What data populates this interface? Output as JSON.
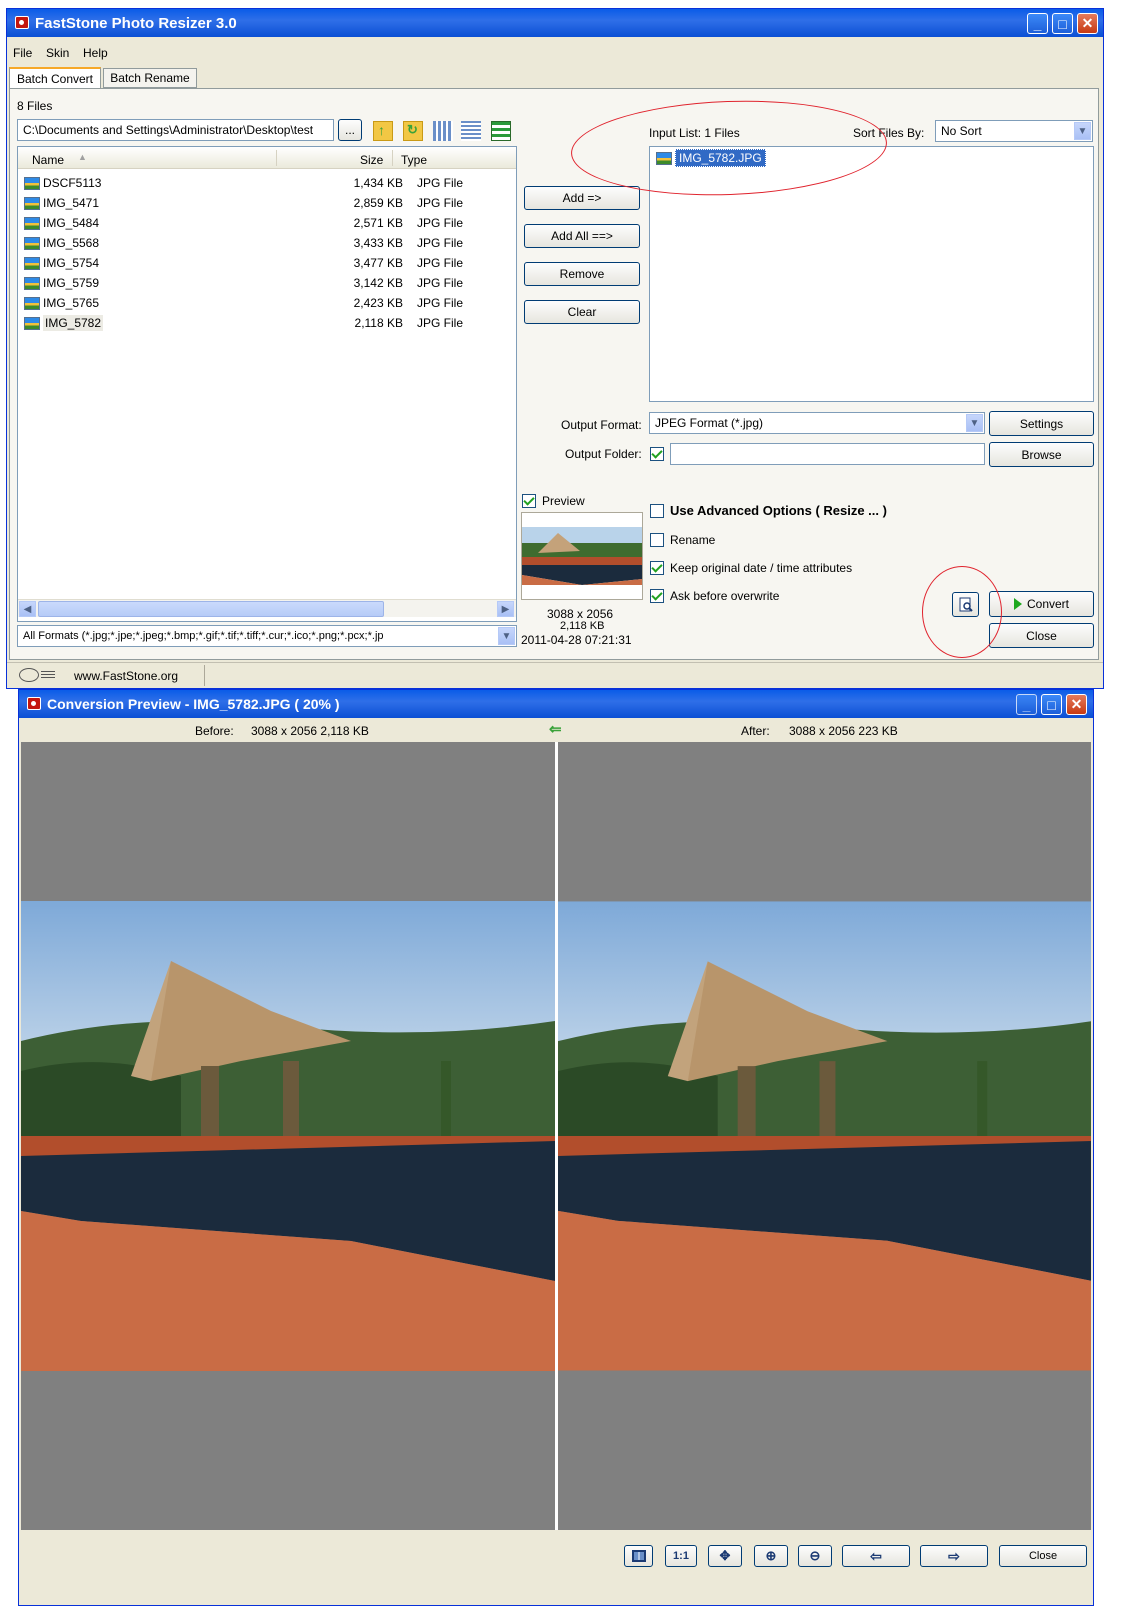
{
  "main_window": {
    "title": "FastStone Photo Resizer 3.0",
    "menu": [
      "File",
      "Skin",
      "Help"
    ],
    "tabs": [
      "Batch Convert",
      "Batch Rename"
    ],
    "files_count": "8 Files",
    "path": "C:\\Documents and Settings\\Administrator\\Desktop\\test",
    "browse_btn": "...",
    "columns": {
      "name": "Name",
      "size": "Size",
      "type": "Type"
    },
    "files": [
      {
        "name": "DSCF5113",
        "size": "1,434 KB",
        "type": "JPG File"
      },
      {
        "name": "IMG_5471",
        "size": "2,859 KB",
        "type": "JPG File"
      },
      {
        "name": "IMG_5484",
        "size": "2,571 KB",
        "type": "JPG File"
      },
      {
        "name": "IMG_5568",
        "size": "3,433 KB",
        "type": "JPG File"
      },
      {
        "name": "IMG_5754",
        "size": "3,477 KB",
        "type": "JPG File"
      },
      {
        "name": "IMG_5759",
        "size": "3,142 KB",
        "type": "JPG File"
      },
      {
        "name": "IMG_5765",
        "size": "2,423 KB",
        "type": "JPG File"
      },
      {
        "name": "IMG_5782",
        "size": "2,118 KB",
        "type": "JPG File"
      }
    ],
    "filter": "All Formats (*.jpg;*.jpe;*.jpeg;*.bmp;*.gif;*.tif;*.tiff;*.cur;*.ico;*.png;*.pcx;*.jp",
    "buttons": {
      "add": "Add =>",
      "add_all": "Add All ==>",
      "remove": "Remove",
      "clear": "Clear"
    },
    "input_list_label": "Input List:  1 Files",
    "sort_label": "Sort Files By:",
    "sort_value": "No Sort",
    "input_files": [
      "IMG_5782.JPG"
    ],
    "output_format_label": "Output Format:",
    "output_format_value": "JPEG Format (*.jpg)",
    "settings_btn": "Settings",
    "output_folder_label": "Output Folder:",
    "browse_btn2": "Browse",
    "preview_label": "Preview",
    "preview_dims": "3088 x 2056",
    "preview_size": "2,118 KB",
    "preview_date": "2011-04-28 07:21:31",
    "options": {
      "advanced": "Use Advanced Options ( Resize ... )",
      "rename": "Rename",
      "keep_date": "Keep original date / time attributes",
      "ask_overwrite": "Ask before overwrite"
    },
    "convert_btn": "Convert",
    "close_btn": "Close",
    "status_url": "www.FastStone.org"
  },
  "preview_window": {
    "title": "Conversion Preview - IMG_5782.JPG  ( 20% )",
    "before_label": "Before:",
    "before_info": "3088 x 2056    2,118 KB",
    "after_label": "After:",
    "after_info": "3088 x 2056    223 KB",
    "tool_1to1": "1:1",
    "close_btn": "Close"
  },
  "colors": {
    "accent": "#0a5ce8",
    "annotation": "#e0232d",
    "selection": "#316ac5"
  }
}
